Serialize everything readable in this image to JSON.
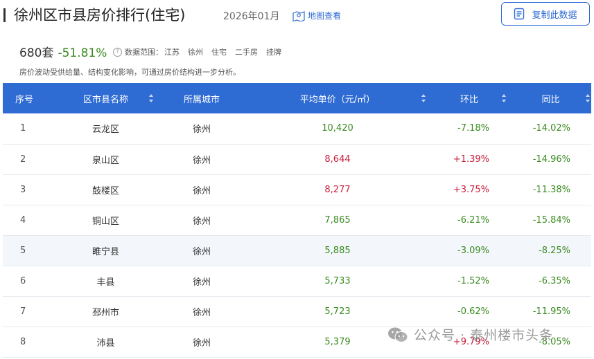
{
  "header": {
    "title": "徐州区市县房价排行(住宅)",
    "date": "2026年01月",
    "map_link": "地图查看",
    "copy_button": "复制此数据"
  },
  "stats": {
    "count": "680套",
    "change": "-51.81%",
    "scope_label": "数据范围：",
    "scope_tags": [
      "江苏",
      "徐州",
      "住宅",
      "二手房",
      "挂牌"
    ],
    "note": "房价波动受供给量、结构变化影响，可通过房价结构进一步分析。"
  },
  "table": {
    "headers": {
      "index": "序号",
      "district": "区市县名称",
      "city": "所属城市",
      "price": "平均单价（元/㎡）",
      "mom": "环比",
      "yoy": "同比"
    },
    "rows": [
      {
        "index": "1",
        "district": "云龙区",
        "city": "徐州",
        "price": "10,420",
        "mom": "-7.18%",
        "yoy": "-14.02%"
      },
      {
        "index": "2",
        "district": "泉山区",
        "city": "徐州",
        "price": "8,644",
        "mom": "+1.39%",
        "yoy": "-14.96%"
      },
      {
        "index": "3",
        "district": "鼓楼区",
        "city": "徐州",
        "price": "8,277",
        "mom": "+3.75%",
        "yoy": "-11.38%"
      },
      {
        "index": "4",
        "district": "铜山区",
        "city": "徐州",
        "price": "7,865",
        "mom": "-6.21%",
        "yoy": "-15.84%"
      },
      {
        "index": "5",
        "district": "睢宁县",
        "city": "徐州",
        "price": "5,885",
        "mom": "-3.09%",
        "yoy": "-8.25%"
      },
      {
        "index": "6",
        "district": "丰县",
        "city": "徐州",
        "price": "5,733",
        "mom": "-1.52%",
        "yoy": "-6.35%"
      },
      {
        "index": "7",
        "district": "邳州市",
        "city": "徐州",
        "price": "5,723",
        "mom": "-0.62%",
        "yoy": "-11.95%"
      },
      {
        "index": "8",
        "district": "沛县",
        "city": "徐州",
        "price": "5,379",
        "mom": "+9.79%",
        "yoy": "-8.05%"
      }
    ],
    "highlighted_row": "5"
  },
  "watermark": {
    "text": "公众号 · 泰州楼市头条"
  },
  "colors": {
    "accent": "#2e6bd3",
    "up": "#c8203d",
    "down": "#3a8a1f"
  },
  "icons": {
    "map": "map-pin-icon",
    "copy": "document-copy-icon",
    "help": "question-circle-icon",
    "sort": "sort-arrows-icon",
    "watermark": "wechat-icon"
  }
}
